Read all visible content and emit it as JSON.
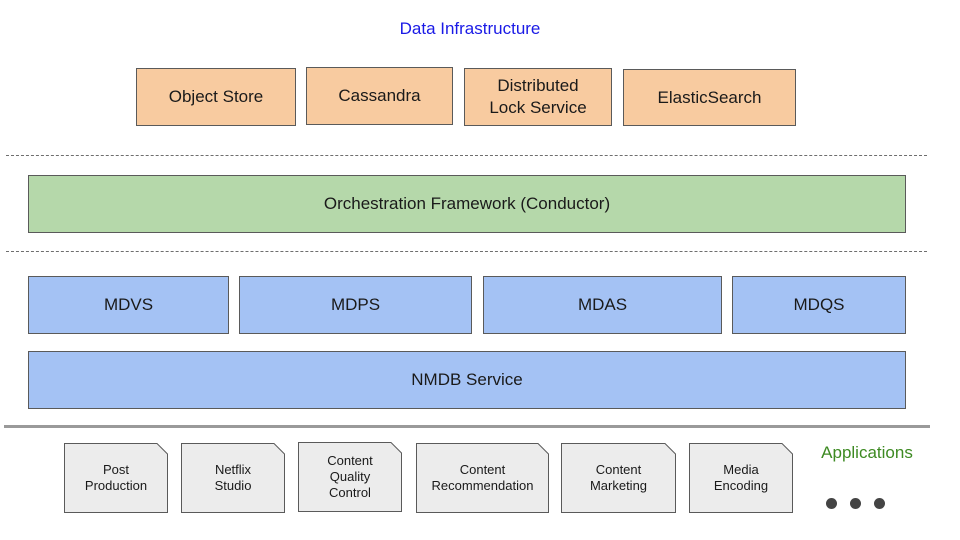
{
  "title": "Data Infrastructure",
  "infrastructure": [
    {
      "label": "Object Store"
    },
    {
      "label": "Cassandra"
    },
    {
      "label": "Distributed\nLock Service"
    },
    {
      "label": "ElasticSearch"
    }
  ],
  "orchestration": {
    "label": "Orchestration Framework (Conductor)"
  },
  "services": [
    {
      "label": "MDVS"
    },
    {
      "label": "MDPS"
    },
    {
      "label": "MDAS"
    },
    {
      "label": "MDQS"
    }
  ],
  "nmdb": {
    "label": "NMDB Service"
  },
  "applications": {
    "label": "Applications",
    "items": [
      {
        "label": "Post\nProduction"
      },
      {
        "label": "Netflix\nStudio"
      },
      {
        "label": "Content\nQuality\nControl"
      },
      {
        "label": "Content\nRecommendation"
      },
      {
        "label": "Content\nMarketing"
      },
      {
        "label": "Media\nEncoding"
      }
    ],
    "more_icon": "ellipsis-dots"
  },
  "colors": {
    "title": "#1a1ae6",
    "infrastructure": "#f8cba0",
    "orchestration": "#b5d8aa",
    "services": "#a4c2f4",
    "application_card": "#ececec",
    "applications_label": "#3d8a22"
  }
}
